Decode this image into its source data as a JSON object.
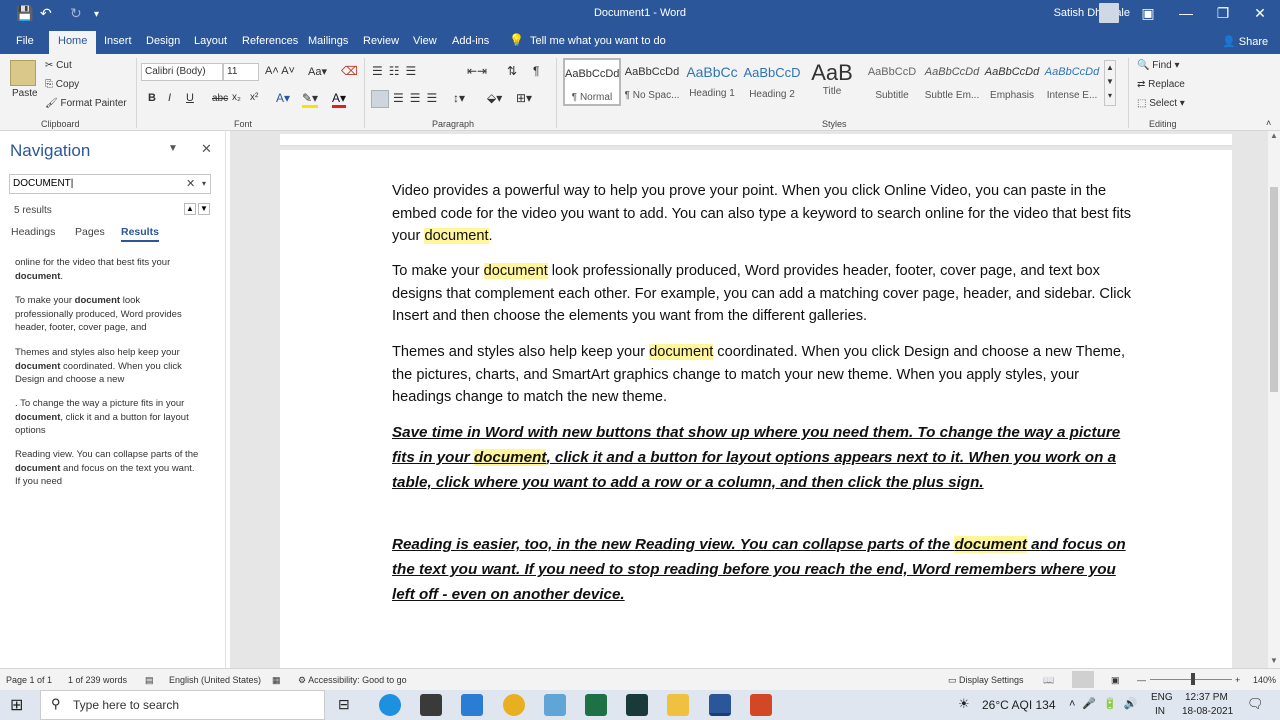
{
  "titlebar": {
    "doc_title": "Document1 - Word",
    "user": "Satish Dhawale",
    "qa_save": "💾",
    "qa_undo": "↶",
    "qa_redo": "↻",
    "qa_more": "▾"
  },
  "tabs": [
    "File",
    "Home",
    "Insert",
    "Design",
    "Layout",
    "References",
    "Mailings",
    "Review",
    "View",
    "Add-ins"
  ],
  "tell_me": "Tell me what you want to do",
  "share": "Share",
  "clipboard": {
    "paste": "Paste",
    "cut": "Cut",
    "copy": "Copy",
    "format_painter": "Format Painter",
    "label": "Clipboard"
  },
  "font": {
    "name": "Calibri (Body)",
    "size": "11",
    "label": "Font",
    "bold": "B",
    "italic": "I",
    "underline": "U",
    "strike": "abc",
    "sub": "x₂",
    "sup": "x²"
  },
  "paragraph": {
    "label": "Paragraph"
  },
  "styles": {
    "label": "Styles",
    "items": [
      {
        "preview": "AaBbCcDd",
        "name": "¶ Normal"
      },
      {
        "preview": "AaBbCcDd",
        "name": "¶ No Spac..."
      },
      {
        "preview": "AaBbCc",
        "name": "Heading 1"
      },
      {
        "preview": "AaBbCcD",
        "name": "Heading 2"
      },
      {
        "preview": "AaB",
        "name": "Title"
      },
      {
        "preview": "AaBbCcD",
        "name": "Subtitle"
      },
      {
        "preview": "AaBbCcDd",
        "name": "Subtle Em..."
      },
      {
        "preview": "AaBbCcDd",
        "name": "Emphasis"
      },
      {
        "preview": "AaBbCcDd",
        "name": "Intense E..."
      }
    ]
  },
  "editing": {
    "find": "Find",
    "replace": "Replace",
    "select": "Select",
    "label": "Editing"
  },
  "nav": {
    "title": "Navigation",
    "search": "DOCUMENT",
    "count": "5 results",
    "tabs": [
      "Headings",
      "Pages",
      "Results"
    ],
    "results": [
      {
        "pre": "online for the video that best fits your ",
        "hit": "document",
        "post": "."
      },
      {
        "pre": "To make your ",
        "hit": "document",
        "post": " look professionally produced, Word provides header, footer, cover page, and"
      },
      {
        "pre": "Themes and styles also help keep your ",
        "hit": "document",
        "post": " coordinated. When you click Design and choose a new"
      },
      {
        "pre": ". To change the way a picture fits in your ",
        "hit": "document",
        "post": ", click it and a button for layout options"
      },
      {
        "pre": "Reading view. You can collapse parts of the ",
        "hit": "document",
        "post": " and focus on the text you want. If you need"
      }
    ]
  },
  "doc": {
    "p1": {
      "a": "Video provides a powerful way to help you prove your point. When you click Online Video, you can paste in the embed code for the video you want to add. You can also type a keyword to search online for the video that best fits your ",
      "hl": "document",
      "b": "."
    },
    "p2": {
      "a": "To make your ",
      "hl": "document",
      "b": " look professionally produced, Word provides header, footer, cover page, and text box designs that complement each other. For example, you can add a matching cover page, header, and sidebar. Click Insert and then choose the elements you want from the different galleries."
    },
    "p3": {
      "a": "Themes and styles also help keep your ",
      "hl": "document",
      "b": " coordinated. When you click Design and choose a new Theme, the pictures, charts, and SmartArt graphics change to match your new theme. When you apply styles, your headings change to match the new theme."
    },
    "p4": {
      "a": "Save time in Word with new buttons that show up where you need them. To change the way a picture fits in your ",
      "hl": "document",
      "b": ", click it and a button for layout options appears next to it. When you work on a table, click where you want to add a row or a column, and then click the plus sign."
    },
    "p5": {
      "a": "Reading is easier, too, in the new Reading view. You can collapse parts of the ",
      "hl": "document",
      "b": " and focus on the text you want. If you need to stop reading before you reach the end, Word remembers where you left off - even on another device."
    }
  },
  "status": {
    "page": "Page 1 of 1",
    "words": "1 of 239 words",
    "lang": "English (United States)",
    "access": "Accessibility: Good to go",
    "display": "Display Settings",
    "zoom": "140%"
  },
  "taskbar": {
    "search": "Type here to search",
    "weather": "26°C  AQI 134",
    "lang1": "ENG",
    "lang2": "IN",
    "time": "12:37 PM",
    "date": "18-08-2021"
  },
  "colors": {
    "accent": "#2b579a",
    "highlight": "#fff59a"
  }
}
